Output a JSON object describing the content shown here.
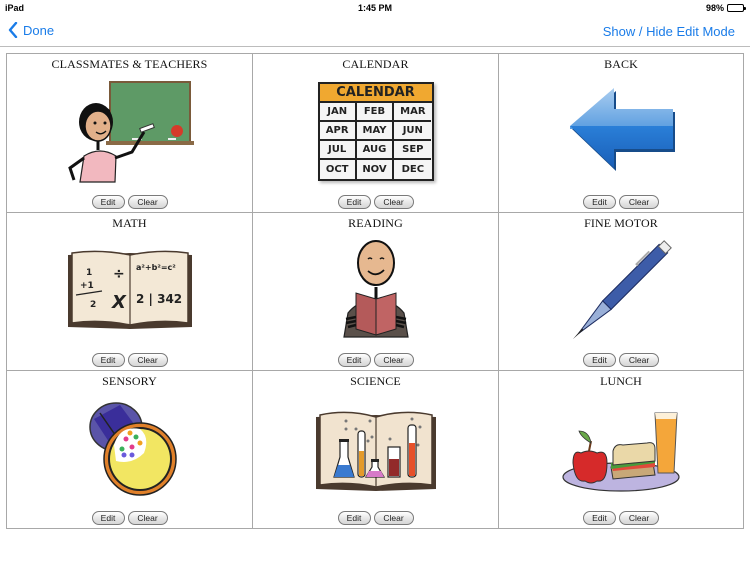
{
  "status_bar": {
    "device": "iPad",
    "time": "1:45 PM",
    "battery": "98%",
    "battery_level": 0.98
  },
  "nav": {
    "back_label": "Done",
    "right_label": "Show / Hide Edit Mode",
    "accent_color": "#1a7ce8"
  },
  "grid": {
    "cells": [
      {
        "title": "CLASSMATES & TEACHERS",
        "image": "teacher-at-chalkboard",
        "edit_label": "Edit",
        "clear_label": "Clear"
      },
      {
        "title": "CALENDAR",
        "image": "calendar",
        "edit_label": "Edit",
        "clear_label": "Clear",
        "calendar": {
          "header": "CALENDAR",
          "months": [
            "JAN",
            "FEB",
            "MAR",
            "APR",
            "MAY",
            "JUN",
            "JUL",
            "AUG",
            "SEP",
            "OCT",
            "NOV",
            "DEC"
          ]
        }
      },
      {
        "title": "BACK",
        "image": "blue-left-arrow",
        "edit_label": "Edit",
        "clear_label": "Clear"
      },
      {
        "title": "MATH",
        "image": "math-book",
        "edit_label": "Edit",
        "clear_label": "Clear",
        "math": {
          "formula": "a²+b²=c²",
          "division": "2 | 342",
          "multiply": "X",
          "fraction_top": "1",
          "fraction_add": "+1",
          "fraction_result": "2",
          "divide": "÷"
        }
      },
      {
        "title": "READING",
        "image": "person-reading-book",
        "edit_label": "Edit",
        "clear_label": "Clear"
      },
      {
        "title": "FINE MOTOR",
        "image": "pen",
        "edit_label": "Edit",
        "clear_label": "Clear"
      },
      {
        "title": "SENSORY",
        "image": "kaleidoscope",
        "edit_label": "Edit",
        "clear_label": "Clear"
      },
      {
        "title": "SCIENCE",
        "image": "science-book-beakers",
        "edit_label": "Edit",
        "clear_label": "Clear"
      },
      {
        "title": "LUNCH",
        "image": "lunch-plate",
        "edit_label": "Edit",
        "clear_label": "Clear"
      }
    ]
  }
}
